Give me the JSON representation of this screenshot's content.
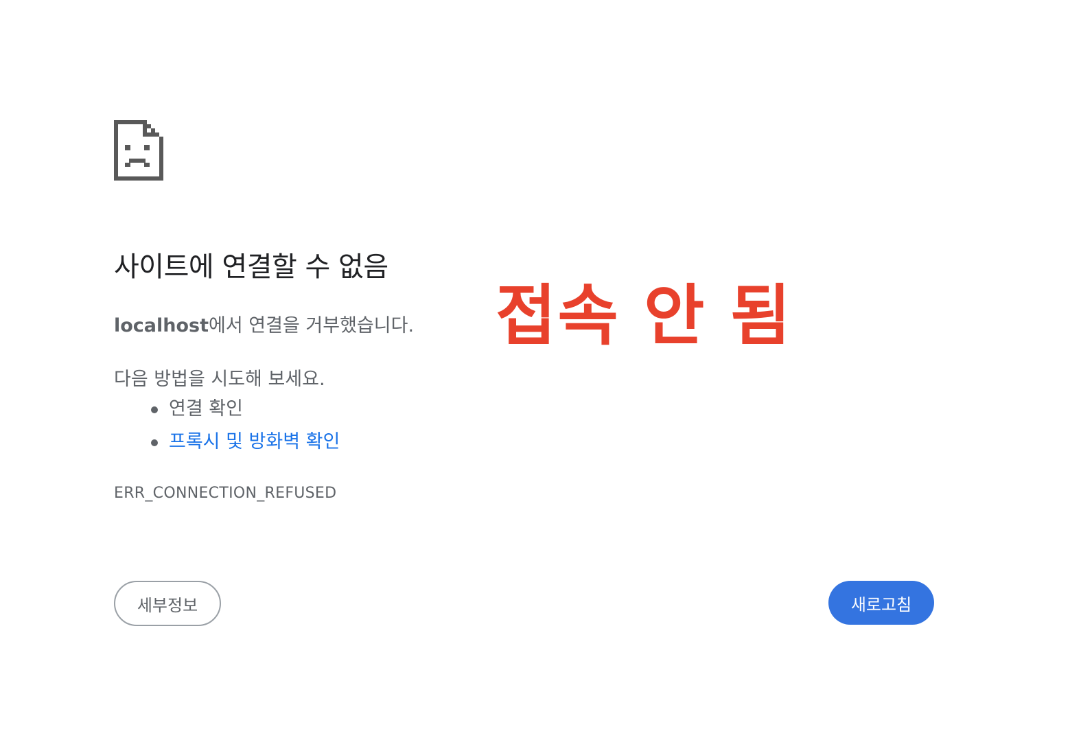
{
  "icons": {
    "error_icon": "sad-page-icon"
  },
  "main": {
    "title": "사이트에 연결할 수 없음",
    "detail_host": "localhost",
    "detail_rest": "에서 연결을 거부했습니다.",
    "suggestions_heading": "다음 방법을 시도해 보세요.",
    "suggestions": [
      {
        "label": "연결 확인",
        "is_link": false
      },
      {
        "label": "프록시 및 방화벽 확인",
        "is_link": true
      }
    ],
    "error_code": "ERR_CONNECTION_REFUSED"
  },
  "buttons": {
    "details_label": "세부정보",
    "reload_label": "새로고침"
  },
  "annotation": {
    "text": "접속 안 됨"
  },
  "colors": {
    "link": "#1a73e8",
    "primary_button": "#3474e0",
    "annotation": "#e8412c",
    "secondary_text": "#5f6368",
    "icon": "#5f6368"
  }
}
